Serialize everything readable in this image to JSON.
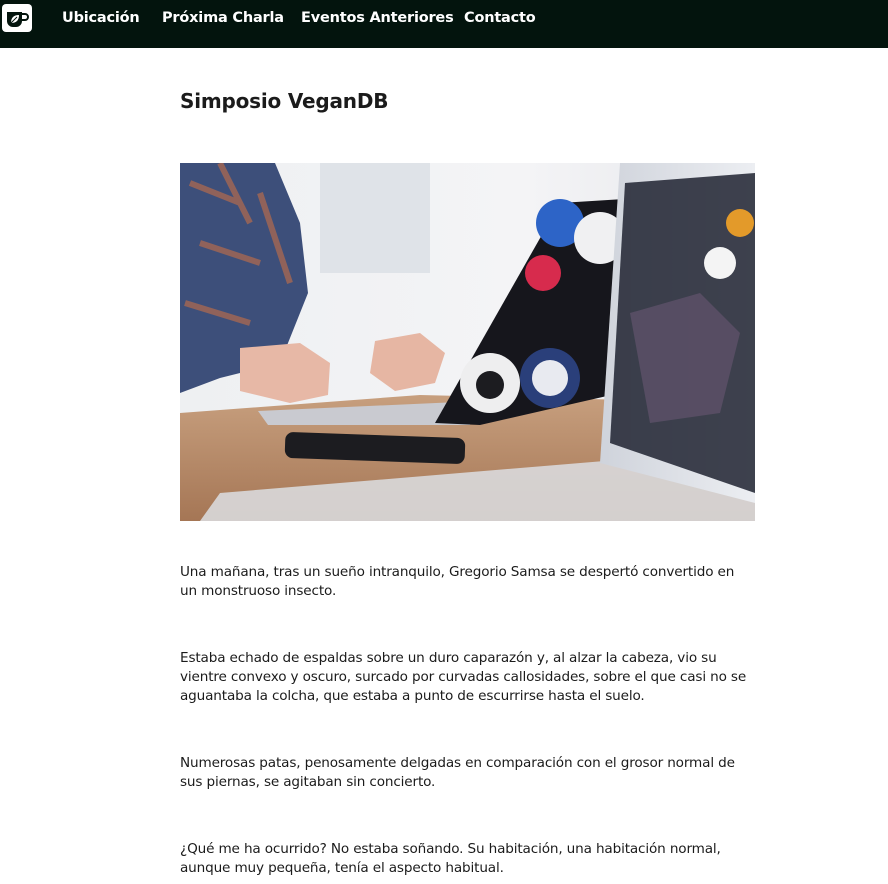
{
  "nav": {
    "logo_icon": "coffee-cup-leaf-icon",
    "links": [
      "Ubicación",
      "Próxima Charla",
      "Eventos Anteriores",
      "Contacto"
    ]
  },
  "main": {
    "title": "Simposio VeganDB",
    "hero_image": "laptop-with-stickers-photo",
    "paragraphs": [
      "Una mañana, tras un sueño intranquilo, Gregorio Samsa se despertó convertido en un monstruoso insecto.",
      "Estaba echado de espaldas sobre un duro caparazón y, al alzar la cabeza, vio su vientre convexo y oscuro, surcado por curvadas callosidades, sobre el que casi no se aguantaba la colcha, que estaba a punto de escurrirse hasta el suelo.",
      "Numerosas patas, penosamente delgadas en comparación con el grosor normal de sus piernas, se agitaban sin concierto.",
      "¿Qué me ha ocurrido? No estaba soñando. Su habitación, una habitación normal, aunque muy pequeña, tenía el aspecto habitual."
    ]
  },
  "colors": {
    "nav_background": "#03140d",
    "nav_text": "#ffffff",
    "body_text": "#1b1b1b"
  }
}
